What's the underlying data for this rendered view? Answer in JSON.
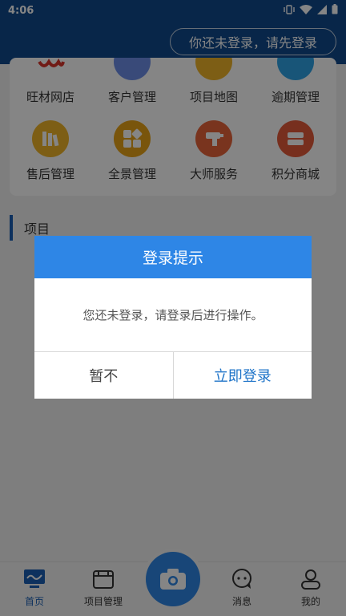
{
  "status_bar": {
    "time": "4:06"
  },
  "header": {
    "login_prompt": "你还未登录，请先登录"
  },
  "grid": {
    "row1": [
      {
        "label": "旺材网店",
        "icon": "shop-icon",
        "color": "#e74c3c"
      },
      {
        "label": "客户管理",
        "icon": "customer-icon",
        "color": "#5b8def"
      },
      {
        "label": "项目地图",
        "icon": "map-icon",
        "color": "#f0b429"
      },
      {
        "label": "逾期管理",
        "icon": "overdue-icon",
        "color": "#2ea3e6"
      }
    ],
    "row2": [
      {
        "label": "售后管理",
        "icon": "books-icon",
        "color": "#f0b429"
      },
      {
        "label": "全景管理",
        "icon": "panorama-grid-icon",
        "color": "#e8a317"
      },
      {
        "label": "大师服务",
        "icon": "drill-icon",
        "color": "#e8643a"
      },
      {
        "label": "积分商城",
        "icon": "points-store-icon",
        "color": "#e45a3b"
      }
    ]
  },
  "section": {
    "title": "项目"
  },
  "dialog": {
    "title": "登录提示",
    "message": "您还未登录，请登录后进行操作。",
    "cancel_label": "暂不",
    "confirm_label": "立即登录"
  },
  "bottom_nav": {
    "home": "首页",
    "projects": "项目管理",
    "messages": "消息",
    "mine": "我的"
  },
  "colors": {
    "header_bg": "#114a8c",
    "dialog_head": "#2e86e6",
    "accent": "#1a5fb4"
  }
}
